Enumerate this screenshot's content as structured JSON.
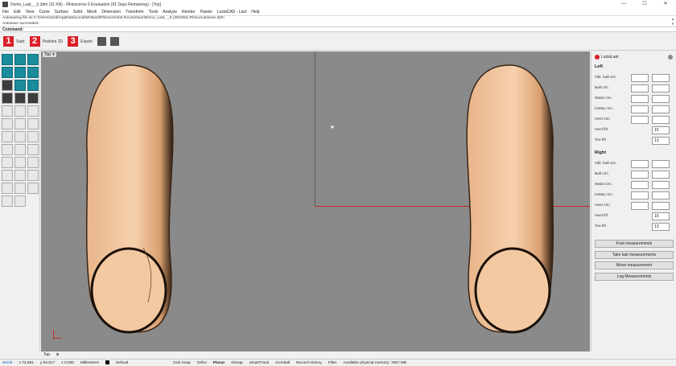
{
  "window": {
    "title": "Demo_Last_ _5.3dm (31 KB) - Rhinoceros 6 Evaluation (91 Days Remaining) - [Top]",
    "controls": [
      "—",
      "☐",
      "✕"
    ]
  },
  "menu": [
    "File",
    "Edit",
    "View",
    "Curve",
    "Surface",
    "Solid",
    "Mesh",
    "Dimension",
    "Transform",
    "Tools",
    "Analyze",
    "Render",
    "Panels",
    "LuxiaCAD - Last",
    "Help"
  ],
  "command_history": [
    "Autosaving file as C:\\Users\\Jordi\\AppData\\Local\\McNeel\\Rhinoceros\\6.0\\AutoSave\\Demo_Last_ _5 (461064) RhinoAutosave.3dm",
    "Autosave succeeded"
  ],
  "command_label": "Command:",
  "steps": [
    {
      "num": "1",
      "label": "Start"
    },
    {
      "num": "2",
      "label": "Position 2D"
    },
    {
      "num": "3",
      "label": "Export"
    }
  ],
  "viewport": {
    "label": "Top",
    "tab": "Top"
  },
  "panel": {
    "title": "LuxiaLast",
    "left_section": "Left",
    "right_section": "Right",
    "left_rows": [
      {
        "label": "Obl. ball circ.",
        "a": "",
        "b": ""
      },
      {
        "label": "Ball circ.",
        "a": "",
        "b": ""
      },
      {
        "label": "Waist circ.",
        "a": "",
        "b": ""
      },
      {
        "label": "Instep circ.",
        "a": "",
        "b": ""
      },
      {
        "label": "Heel circ.",
        "a": "",
        "b": ""
      }
    ],
    "left_heel_lift": {
      "label": "Heel lift",
      "value": "15"
    },
    "left_toe_lift": {
      "label": "Toe lift",
      "value": "13"
    },
    "right_rows": [
      {
        "label": "Obl. ball circ.",
        "a": "",
        "b": ""
      },
      {
        "label": "Ball circ.",
        "a": "",
        "b": ""
      },
      {
        "label": "Waist circ.",
        "a": "",
        "b": ""
      },
      {
        "label": "Instep circ.",
        "a": "",
        "b": ""
      },
      {
        "label": "Heel circ.",
        "a": "",
        "b": ""
      }
    ],
    "right_heel_lift": {
      "label": "Heel lift",
      "value": "15"
    },
    "right_toe_lift": {
      "label": "Toe lift",
      "value": "13"
    },
    "buttons": [
      "Foot measurements",
      "Take last measurements",
      "Move measurement",
      "Log Measurements"
    ]
  },
  "status": {
    "world": "World",
    "x": "x 73.681",
    "y": "y 94.617",
    "z": "z 0.000",
    "units": "Millimeters",
    "layer": "Default",
    "toggles": [
      "Grid Snap",
      "Ortho",
      "Planar",
      "Osnap",
      "SmartTrack",
      "Gumball",
      "Record History",
      "Filter"
    ],
    "memory": "Available physical memory: 7667 MB"
  },
  "colors": {
    "accent_red": "#d9202a",
    "tool_teal": "#1a8c9c",
    "viewport_bg": "#8a8a8a",
    "last_skin": "#f3c9a2"
  }
}
